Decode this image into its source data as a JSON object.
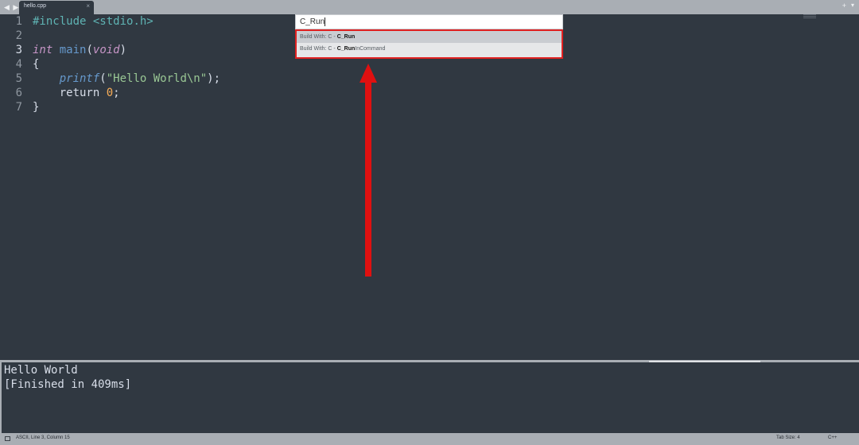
{
  "tabs": [
    {
      "label": "hello.cpp",
      "close": "×"
    }
  ],
  "tabbar": {
    "nav": "◀ ▶",
    "plus": "+",
    "menu": "▾"
  },
  "editor": {
    "line_numbers": [
      "1",
      "2",
      "3",
      "4",
      "5",
      "6",
      "7"
    ],
    "active_line": 3,
    "code": {
      "l1": {
        "directive": "#include",
        "header": "<stdio.h>"
      },
      "l3": {
        "type": "int",
        "name": "main",
        "open": "(",
        "param": "void",
        "close": ")"
      },
      "l4": "{",
      "l5": {
        "fn": "printf",
        "open": "(",
        "str": "\"Hello World\\n\"",
        "close": ");"
      },
      "l6": {
        "kw": "return",
        "num": "0",
        "semi": ";"
      },
      "l7": "}"
    }
  },
  "palette": {
    "query": "C_Run",
    "items": [
      {
        "prefix": "Build With: C - ",
        "match": "C_Run",
        "suffix": "",
        "selected": true
      },
      {
        "prefix": "Build With: C - ",
        "match": "C_Run",
        "suffix": "InCommand",
        "selected": false
      }
    ]
  },
  "output": {
    "lines": [
      "Hello World",
      "[Finished in 409ms]"
    ]
  },
  "statusbar": {
    "position": "ASCII, Line 3, Column 15",
    "tab_size": "Tab Size: 4",
    "syntax": "C++"
  },
  "colors": {
    "editor_bg": "#303841",
    "chrome": "#a9aeb4",
    "annotation": "#e01010"
  }
}
